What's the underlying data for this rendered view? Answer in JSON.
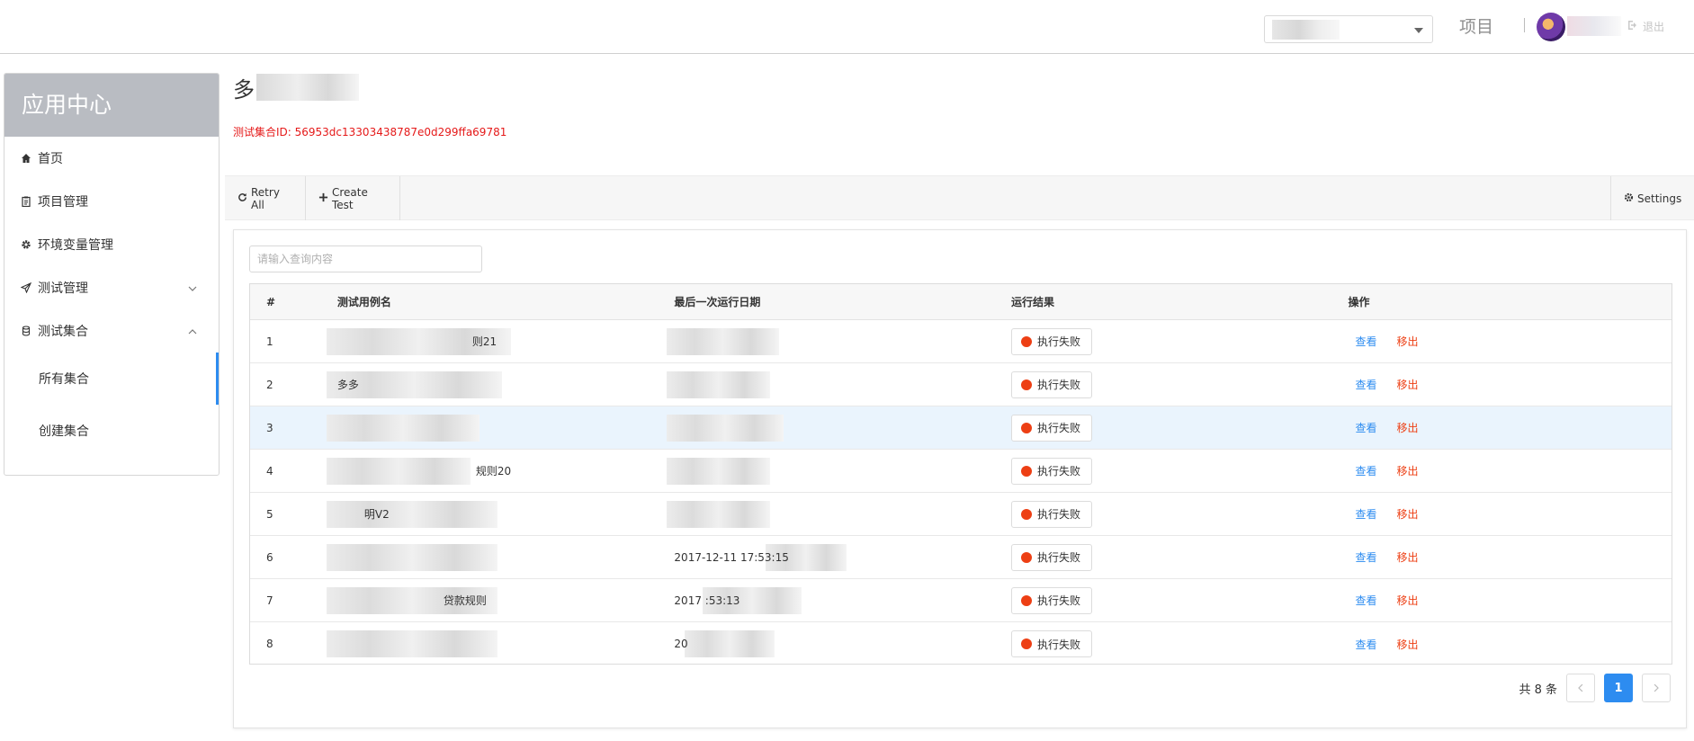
{
  "header": {
    "project_label": "项目",
    "logout_label": "退出"
  },
  "sidebar": {
    "title": "应用中心",
    "items": [
      {
        "label": "首页",
        "icon": "home-icon"
      },
      {
        "label": "项目管理",
        "icon": "clipboard-icon"
      },
      {
        "label": "环境变量管理",
        "icon": "gear-icon"
      },
      {
        "label": "测试管理",
        "icon": "send-icon",
        "expanded": false
      },
      {
        "label": "测试集合",
        "icon": "database-icon",
        "expanded": true
      }
    ],
    "subitems": [
      {
        "label": "所有集合",
        "active": true
      },
      {
        "label": "创建集合",
        "active": false
      }
    ]
  },
  "page": {
    "title_char": "多",
    "suite_id": "测试集合ID: 56953dc13303438787e0d299ffa69781"
  },
  "toolbar": {
    "retry_label": "Retry All",
    "create_label": "Create Test",
    "settings_label": "Settings"
  },
  "search": {
    "placeholder": "请输入查询内容"
  },
  "table": {
    "headers": [
      "#",
      "测试用例名",
      "最后一次运行日期",
      "运行结果",
      "操作"
    ],
    "rows": [
      {
        "index": "1",
        "name": "则21",
        "date": "",
        "status": "执行失败"
      },
      {
        "index": "2",
        "name": "多多",
        "date": "",
        "status": "执行失败"
      },
      {
        "index": "3",
        "name": "",
        "date": "",
        "status": "执行失败"
      },
      {
        "index": "4",
        "name": "规则20",
        "date": "",
        "status": "执行失败"
      },
      {
        "index": "5",
        "name": "明V2",
        "date": "",
        "status": "执行失败"
      },
      {
        "index": "6",
        "name": "",
        "date": "2017-12-11 17:53:15",
        "status": "执行失败"
      },
      {
        "index": "7",
        "name": "贷款规则",
        "date": "2017 :53:13",
        "status": "执行失败"
      },
      {
        "index": "8",
        "name": "",
        "date": "20",
        "status": "执行失败"
      }
    ],
    "view_label": "查看",
    "remove_label": "移出",
    "highlighted_row": 3
  },
  "pagination": {
    "total_label": "共 8 条",
    "current_page": "1"
  },
  "colors": {
    "accent": "#2d8cf0",
    "danger": "#ed3f14",
    "sidebar_header": "#b9bcc2",
    "suite_id": "#e51919"
  }
}
